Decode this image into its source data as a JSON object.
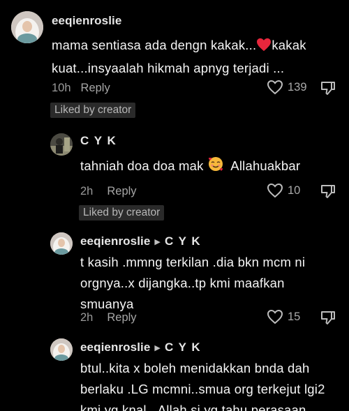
{
  "comments": [
    {
      "username": "eeqienroslie",
      "reply_to": "",
      "text_lines": [
        "mama sentiasa ada dengn kakak...",
        "kakak",
        "kuat...insyaalah hikmah apnyg terjadi ..."
      ],
      "time": "10h",
      "reply_label": "Reply",
      "likes": "139",
      "badge": "Liked by creator"
    },
    {
      "username": "C Y K",
      "reply_to": "",
      "text_lines": [
        "tahniah doa doa mak",
        "Allahuakbar"
      ],
      "time": "2h",
      "reply_label": "Reply",
      "likes": "10",
      "badge": "Liked by creator"
    },
    {
      "username": "eeqienroslie",
      "reply_to": "C Y K",
      "text_lines": [
        "t kasih .mmng terkilan .dia bkn mcm ni",
        "orgnya..x dijangka..tp kmi maafkan",
        "smuanya"
      ],
      "time": "2h",
      "reply_label": "Reply",
      "likes": "15",
      "badge": ""
    },
    {
      "username": "eeqienroslie",
      "reply_to": "C Y K",
      "text_lines": [
        "btul..kita x boleh menidakkan bnda dah",
        "berlaku .LG mcmni..smua org terkejut lgi2",
        "kmi yg knal...Allah si yg tahu perasaan"
      ],
      "time": "",
      "reply_label": "",
      "likes": "",
      "badge": ""
    }
  ],
  "icons": {
    "like": "heart-outline-icon",
    "dislike": "thumbs-down-icon",
    "reply_arrow": "triangle-right-icon",
    "heart_emoji": "red-heart-emoji",
    "smile_emoji": "smiling-face-with-hearts-emoji"
  },
  "colors": {
    "background": "#000000",
    "text": "#f5f5f5",
    "muted": "#9a9a9a",
    "badge_bg": "#2a2a2a",
    "heart": "#e8263c"
  }
}
